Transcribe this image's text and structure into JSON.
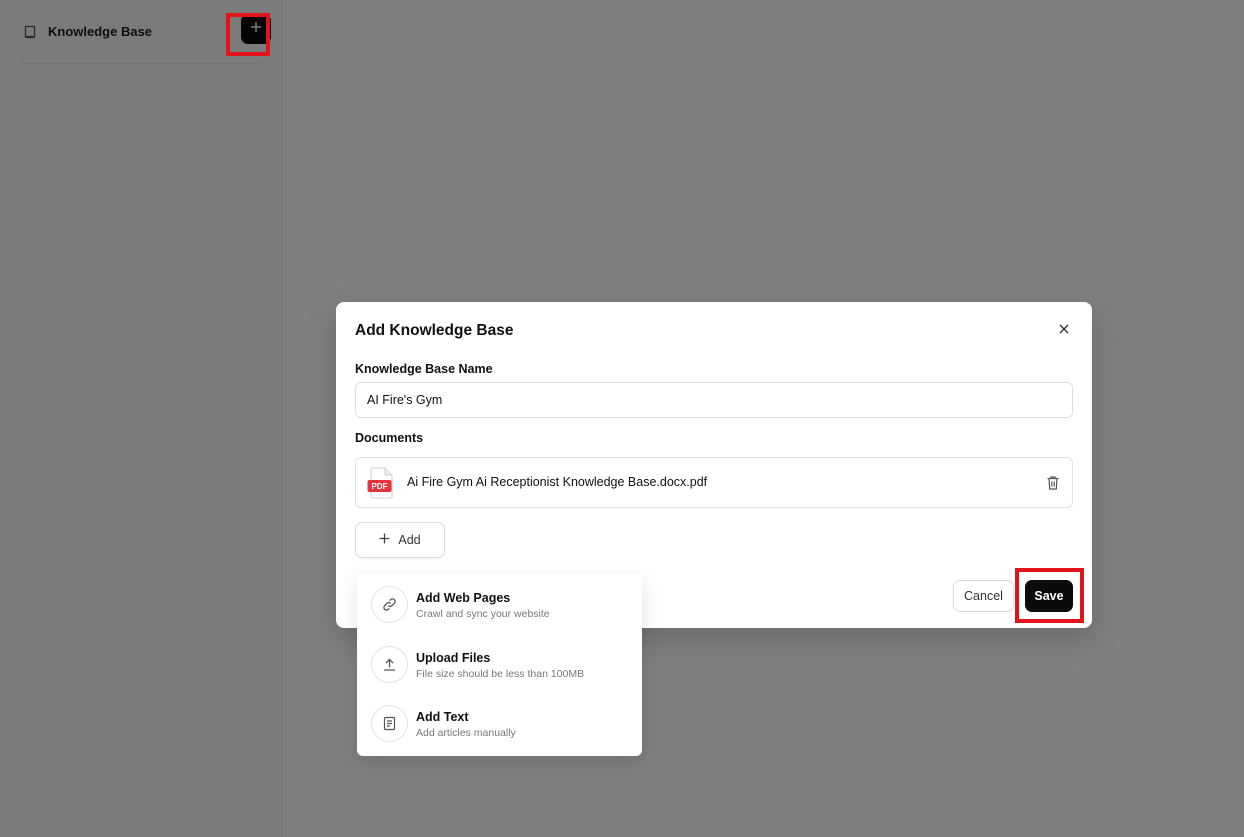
{
  "sidebar": {
    "title": "Knowledge Base"
  },
  "dialog": {
    "title": "Add Knowledge Base",
    "name_label": "Knowledge Base Name",
    "name_value": "AI Fire's Gym",
    "documents_label": "Documents",
    "document": {
      "name": "Ai Fire Gym Ai Receptionist Knowledge Base.docx.pdf",
      "badge": "PDF"
    },
    "add_label": "Add",
    "cancel_label": "Cancel",
    "save_label": "Save"
  },
  "dropdown": {
    "items": [
      {
        "title": "Add Web Pages",
        "subtitle": "Crawl and sync your website",
        "icon": "link-icon"
      },
      {
        "title": "Upload Files",
        "subtitle": "File size should be less than 100MB",
        "icon": "upload-icon"
      },
      {
        "title": "Add Text",
        "subtitle": "Add articles manually",
        "icon": "document-text-icon"
      }
    ]
  },
  "colors": {
    "primary": "#0b0b0b",
    "highlight": "#e0151c",
    "pdf_badge": "#e5343f"
  }
}
